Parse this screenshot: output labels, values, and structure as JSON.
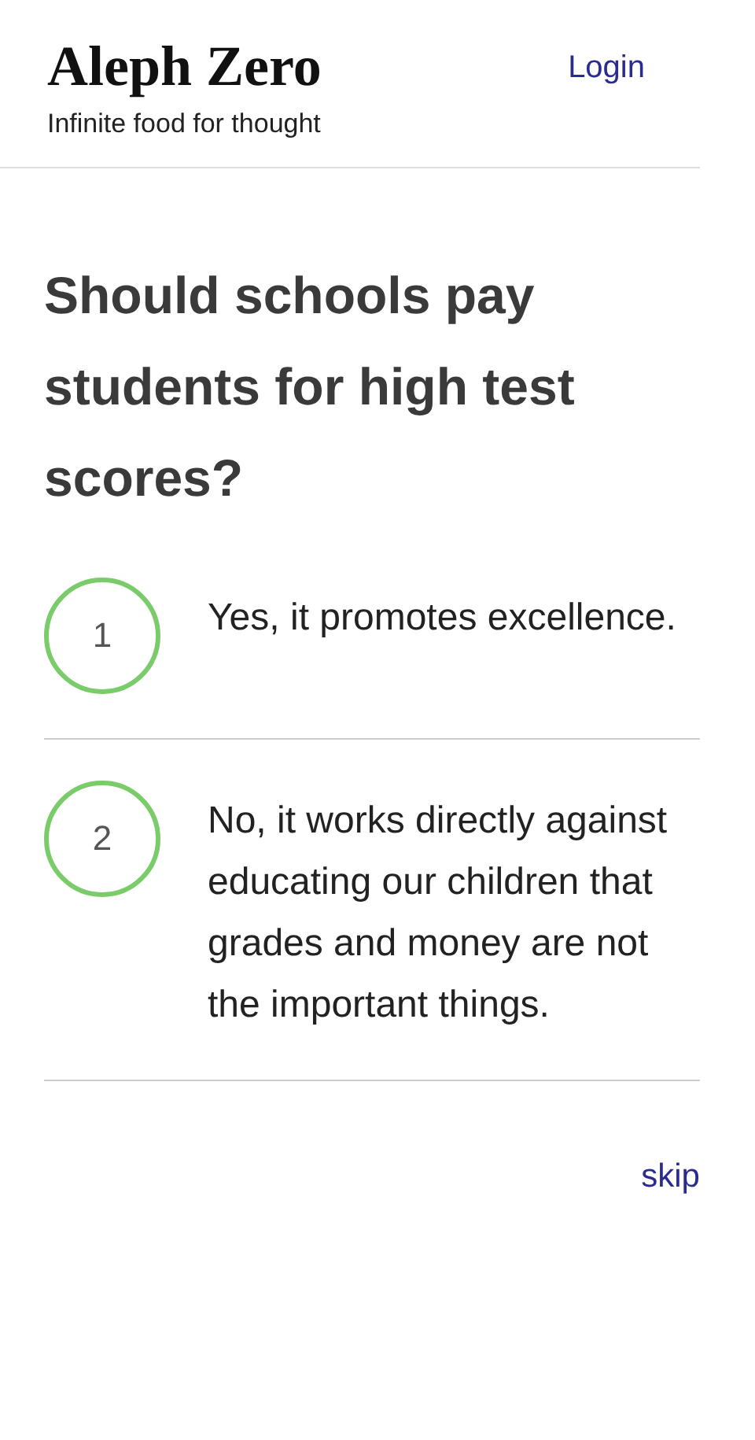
{
  "header": {
    "title": "Aleph Zero",
    "tagline": "Infinite food for thought",
    "login": "Login"
  },
  "question": "Should schools pay students for high test scores?",
  "options": [
    {
      "number": "1",
      "text": "Yes, it promotes excellence."
    },
    {
      "number": "2",
      "text": "No, it works directly against educating our children that grades and money are not the important things."
    }
  ],
  "skip": "skip"
}
